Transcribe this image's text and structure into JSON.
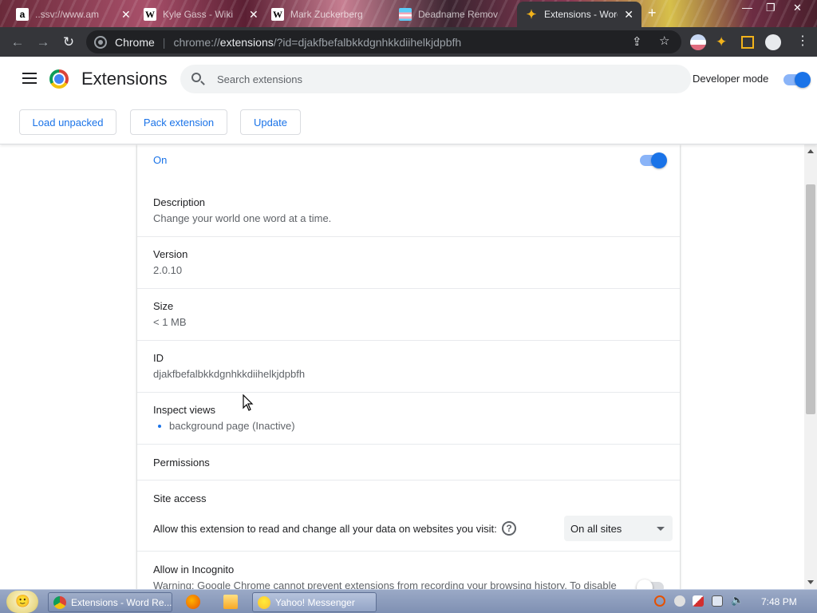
{
  "browser": {
    "tabs": [
      {
        "favicon": "a",
        "title": "..ssv://www.am"
      },
      {
        "favicon": "W",
        "title": "Kyle Gass - Wiki"
      },
      {
        "favicon": "W",
        "title": "Mark Zuckerberg"
      },
      {
        "favicon": "flag",
        "title": "Deadname Remover"
      },
      {
        "favicon": "puzzle",
        "title": "Extensions - Word"
      }
    ],
    "new_tab_label": "+",
    "omnibox": {
      "scheme_label": "Chrome",
      "separator": "|",
      "url_prefix": "chrome://",
      "url_host": "extensions",
      "url_suffix": "/?id=djakfbefalbkkdgnhkkdiihelkjdpbfh"
    }
  },
  "header": {
    "title": "Extensions",
    "search_placeholder": "Search extensions",
    "developer_mode_label": "Developer mode",
    "developer_mode_on": true
  },
  "actions": {
    "load_unpacked": "Load unpacked",
    "pack_extension": "Pack extension",
    "update": "Update"
  },
  "details": {
    "status_label": "On",
    "enabled": true,
    "description_label": "Description",
    "description_value": "Change your world one word at a time.",
    "version_label": "Version",
    "version_value": "2.0.10",
    "size_label": "Size",
    "size_value": "< 1 MB",
    "id_label": "ID",
    "id_value": "djakfbefalbkkdgnhkkdiihelkjdpbfh",
    "inspect_label": "Inspect views",
    "inspect_link": "background page (Inactive)",
    "permissions_label": "Permissions",
    "site_access_label": "Site access",
    "site_access_text": "Allow this extension to read and change all your data on websites you visit:",
    "site_access_value": "On all sites",
    "incognito_label": "Allow in Incognito",
    "incognito_text": "Warning: Google Chrome cannot prevent extensions from recording your browsing history. To disable",
    "incognito_on": false
  },
  "taskbar": {
    "buttons": [
      {
        "label": "Extensions - Word Re..."
      },
      {
        "label": "Yahoo! Messenger"
      }
    ],
    "clock": "7:48 PM"
  },
  "colors": {
    "accent": "#1a73e8",
    "toolbar_bg": "#35363a",
    "taskbar_bg": "#8a9abd"
  }
}
